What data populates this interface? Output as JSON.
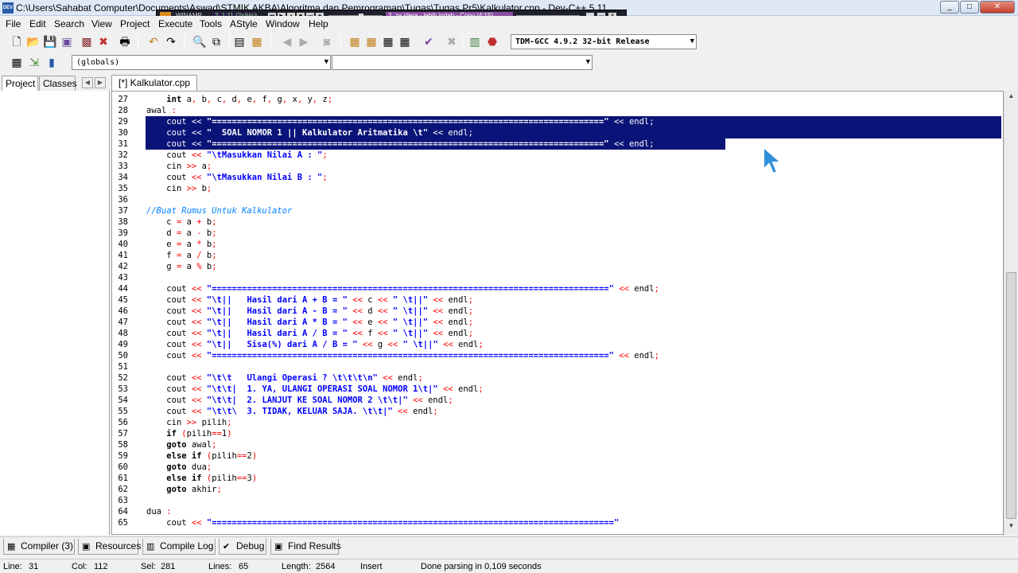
{
  "window": {
    "title": "C:\\Users\\Sahabat Computer\\Documents\\Aswad\\STMIK AKBA\\Algoritma dan Pemrograman\\Tugas\\Tugas Pr5\\Kalkulator.cpp - Dev-C++ 5.11",
    "app_icon": "DEV"
  },
  "winamp": {
    "title": "WINAMP",
    "track": "2. 1:11 (?x/HxY)",
    "track2": "2. za idera - lebih indah - Copy (4:15)"
  },
  "menu": [
    "File",
    "Edit",
    "Search",
    "View",
    "Project",
    "Execute",
    "Tools",
    "AStyle",
    "Window",
    "Help"
  ],
  "compiler_select": "TDM-GCC 4.9.2 32-bit Release",
  "scope_select": "(globals)",
  "member_select": "",
  "left_tabs": [
    "Project",
    "Classes"
  ],
  "editor_tab": "[*] Kalkulator.cpp",
  "code_lines": [
    {
      "num": "27",
      "code": "    int a, b, c, d, e, f, g, x, y, z;"
    },
    {
      "num": "28",
      "code": "awal :"
    },
    {
      "num": "29",
      "code": "    cout << \"==============================================================================\" << endl;"
    },
    {
      "num": "30",
      "code": "    cout << \"  SOAL NOMOR 1 || Kalkulator Aritmatika \\t\" << endl;"
    },
    {
      "num": "31",
      "code": "    cout << \"==============================================================================\" << endl;"
    },
    {
      "num": "32",
      "code": "    cout << \"\\tMasukkan Nilai A : \";"
    },
    {
      "num": "33",
      "code": "    cin >> a;"
    },
    {
      "num": "34",
      "code": "    cout << \"\\tMasukkan Nilai B : \";"
    },
    {
      "num": "35",
      "code": "    cin >> b;"
    },
    {
      "num": "36",
      "code": ""
    },
    {
      "num": "37",
      "code": "//Buat Rumus Untuk Kalkulator"
    },
    {
      "num": "38",
      "code": "    c = a + b;"
    },
    {
      "num": "39",
      "code": "    d = a - b;"
    },
    {
      "num": "40",
      "code": "    e = a * b;"
    },
    {
      "num": "41",
      "code": "    f = a / b;"
    },
    {
      "num": "42",
      "code": "    g = a % b;"
    },
    {
      "num": "43",
      "code": ""
    },
    {
      "num": "44",
      "code": "    cout << \"===============================================================================\" << endl;"
    },
    {
      "num": "45",
      "code": "    cout << \"\\t||   Hasil dari A + B = \" << c << \" \\t||\" << endl;"
    },
    {
      "num": "46",
      "code": "    cout << \"\\t||   Hasil dari A - B = \" << d << \" \\t||\" << endl;"
    },
    {
      "num": "47",
      "code": "    cout << \"\\t||   Hasil dari A * B = \" << e << \" \\t||\" << endl;"
    },
    {
      "num": "48",
      "code": "    cout << \"\\t||   Hasil dari A / B = \" << f << \" \\t||\" << endl;"
    },
    {
      "num": "49",
      "code": "    cout << \"\\t||   Sisa(%) dari A / B = \" << g << \" \\t||\" << endl;"
    },
    {
      "num": "50",
      "code": "    cout << \"===============================================================================\" << endl;"
    },
    {
      "num": "51",
      "code": ""
    },
    {
      "num": "52",
      "code": "    cout << \"\\t\\t   Ulangi Operasi ? \\t\\t\\t\\n\" << endl;"
    },
    {
      "num": "53",
      "code": "    cout << \"\\t\\t|  1. YA, ULANGI OPERASI SOAL NOMOR 1\\t|\" << endl;"
    },
    {
      "num": "54",
      "code": "    cout << \"\\t\\t|  2. LANJUT KE SOAL NOMOR 2 \\t\\t|\" << endl;"
    },
    {
      "num": "55",
      "code": "    cout << \"\\t\\t\\  3. TIDAK, KELUAR SAJA. \\t\\t|\" << endl;"
    },
    {
      "num": "56",
      "code": "    cin >> pilih;"
    },
    {
      "num": "57",
      "code": "    if (pilih==1)"
    },
    {
      "num": "58",
      "code": "    goto awal;"
    },
    {
      "num": "59",
      "code": "    else if (pilih==2)"
    },
    {
      "num": "60",
      "code": "    goto dua;"
    },
    {
      "num": "61",
      "code": "    else if (pilih==3)"
    },
    {
      "num": "62",
      "code": "    goto akhir;"
    },
    {
      "num": "63",
      "code": ""
    },
    {
      "num": "64",
      "code": "dua :"
    },
    {
      "num": "65",
      "code": "    cout << \"================================================================================\""
    }
  ],
  "bottom_tabs": [
    "Compiler (3)",
    "Resources",
    "Compile Log",
    "Debug",
    "Find Results"
  ],
  "status": {
    "line_label": "Line:",
    "line": "31",
    "col_label": "Col:",
    "col": "112",
    "sel_label": "Sel:",
    "sel": "281",
    "lines_label": "Lines:",
    "lines": "65",
    "length_label": "Length:",
    "length": "2564",
    "mode": "Insert",
    "message": "Done parsing in 0,109 seconds"
  }
}
